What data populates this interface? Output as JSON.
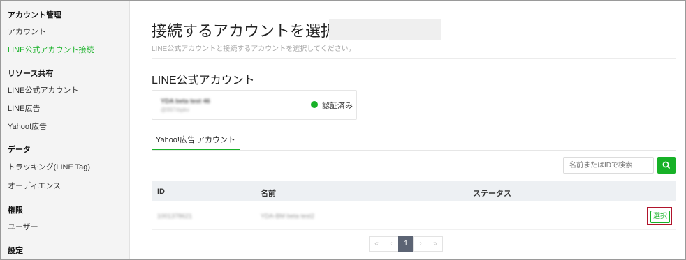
{
  "sidebar": {
    "groups": [
      {
        "title": "アカウント管理",
        "items": [
          "アカウント",
          "LINE公式アカウント接続"
        ]
      },
      {
        "title": "リソース共有",
        "items": [
          "LINE公式アカウント",
          "LINE広告",
          "Yahoo!広告"
        ]
      },
      {
        "title": "データ",
        "items": [
          "トラッキング(LINE Tag)",
          "オーディエンス"
        ]
      },
      {
        "title": "権限",
        "items": [
          "ユーザー"
        ]
      },
      {
        "title": "設定",
        "items": []
      }
    ],
    "active_item": "LINE公式アカウント接続"
  },
  "main": {
    "title": "接続するアカウントを選択 :",
    "subtitle": "LINE公式アカウントと接続するアカウントを選択してください。",
    "section_title": "LINE公式アカウント",
    "account_card": {
      "name": "YDA beta test 46",
      "id": "@997rbpkv",
      "status": "認証済み"
    },
    "tab_label": "Yahoo!広告 アカウント",
    "search": {
      "placeholder": "名前またはIDで検索"
    },
    "table": {
      "columns": [
        "ID",
        "名前",
        "ステータス"
      ],
      "rows": [
        {
          "id": "1001378621",
          "name": "YDA-BM beta test2",
          "status": "",
          "action": "選択"
        }
      ]
    },
    "pagination": {
      "first": "«",
      "prev": "‹",
      "current": "1",
      "next": "›",
      "last": "»"
    }
  },
  "colors": {
    "accent": "#17b127",
    "highlight": "#b0142c",
    "pager_active": "#5c6474"
  }
}
